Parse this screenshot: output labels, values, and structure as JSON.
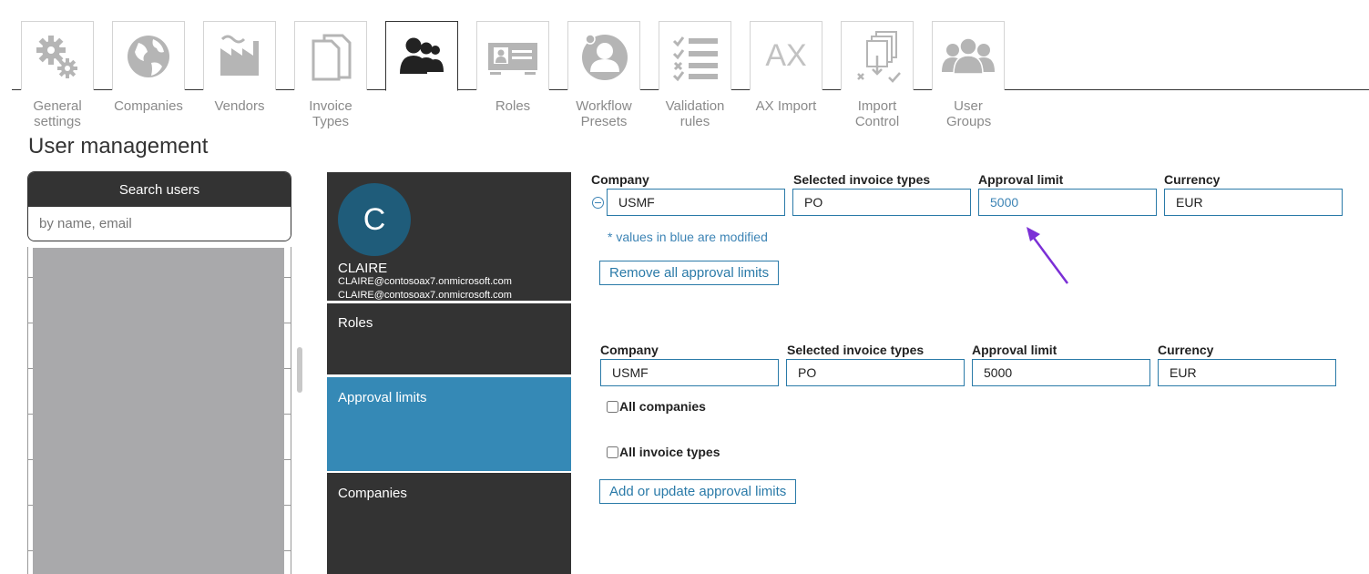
{
  "tabs": [
    {
      "id": "general",
      "label": "General settings",
      "icon": "gears-icon"
    },
    {
      "id": "companies",
      "label": "Companies",
      "icon": "globe-icon"
    },
    {
      "id": "vendors",
      "label": "Vendors",
      "icon": "factory-icon"
    },
    {
      "id": "invoice-types",
      "label": "Invoice Types",
      "icon": "documents-icon"
    },
    {
      "id": "users",
      "label": "",
      "icon": "users-icon",
      "active": true
    },
    {
      "id": "roles",
      "label": "Roles",
      "icon": "id-card-icon"
    },
    {
      "id": "workflow",
      "label": "Workflow Presets",
      "icon": "user-badge-icon"
    },
    {
      "id": "validation",
      "label": "Validation rules",
      "icon": "checklist-icon"
    },
    {
      "id": "ax-import",
      "label": "AX Import",
      "icon": "ax-text-icon",
      "icon_text": "AX"
    },
    {
      "id": "import-control",
      "label": "Import Control",
      "icon": "import-control-icon"
    },
    {
      "id": "user-groups",
      "label": "User Groups",
      "icon": "user-group-icon"
    }
  ],
  "page_title": "User management",
  "search": {
    "header": "Search users",
    "placeholder": "by name, email"
  },
  "profile": {
    "initial": "C",
    "name": "CLAIRE",
    "email_primary": "CLAIRE@contosoax7.onmicrosoft.com",
    "email_secondary": "CLAIRE@contosoax7.onmicrosoft.com"
  },
  "nav": {
    "roles": "Roles",
    "approval_limits": "Approval limits",
    "companies": "Companies"
  },
  "existing_limit": {
    "labels": {
      "company": "Company",
      "invoice_types": "Selected invoice types",
      "approval_limit": "Approval limit",
      "currency": "Currency"
    },
    "values": {
      "company": "USMF",
      "invoice_types": "PO",
      "approval_limit": "5000",
      "currency": "EUR"
    },
    "note": "* values in blue are modified",
    "remove_button": "Remove all approval limits"
  },
  "new_limit": {
    "labels": {
      "company": "Company",
      "invoice_types": "Selected invoice types",
      "approval_limit": "Approval limit",
      "currency": "Currency"
    },
    "values": {
      "company": "USMF",
      "invoice_types": "PO",
      "approval_limit": "5000",
      "currency": "EUR"
    },
    "all_companies": "All companies",
    "all_invoice_types": "All invoice types",
    "add_button": "Add or update approval limits"
  },
  "colors": {
    "accent": "#3589b6",
    "modified": "#3d84b5",
    "dark": "#333333",
    "annotation_arrow": "#7b2fd6"
  }
}
